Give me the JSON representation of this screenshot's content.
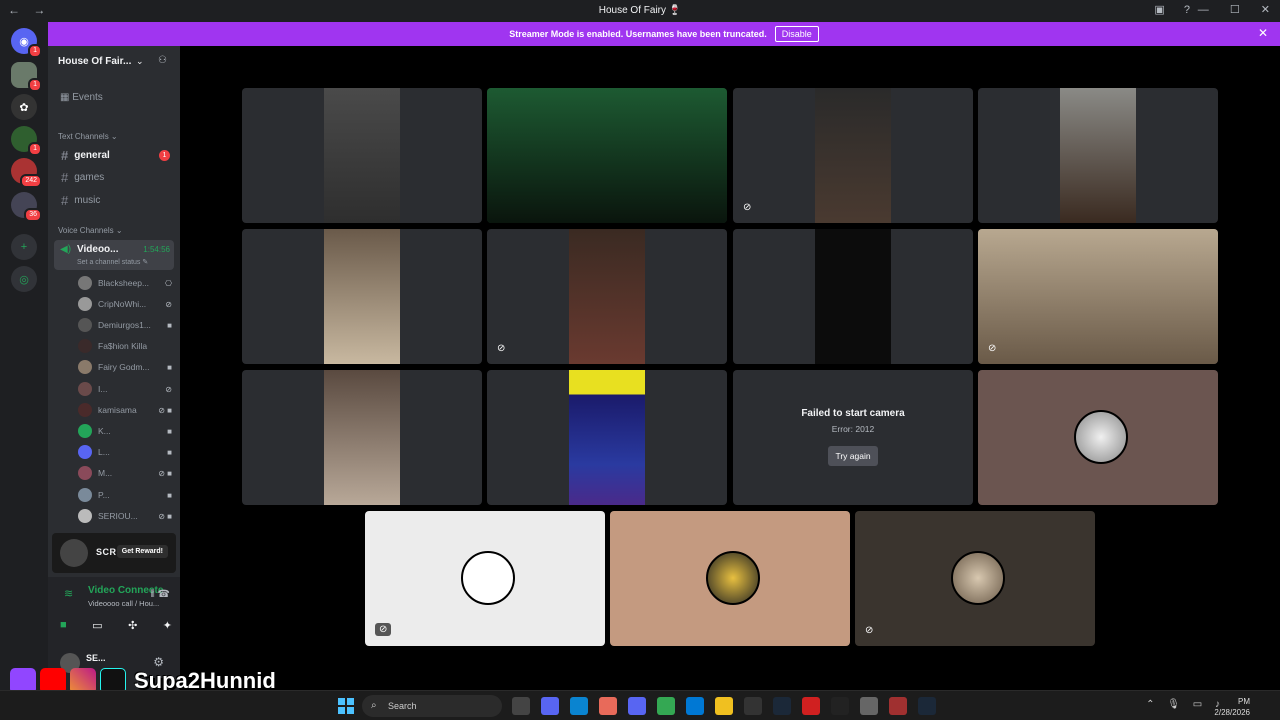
{
  "window": {
    "title": "House Of Fairy 🍷"
  },
  "banner": {
    "text": "Streamer Mode is enabled. Usernames have been truncated.",
    "button": "Disable"
  },
  "servers": {
    "badges": [
      "1",
      "1",
      "1",
      "242",
      "36"
    ]
  },
  "guild": {
    "name": "House Of Fair...",
    "events": "Events",
    "text_category": "Text Channels",
    "text_channels": [
      {
        "name": "general",
        "badge": "1"
      },
      {
        "name": "games"
      },
      {
        "name": "music"
      }
    ],
    "voice_category": "Voice Channels",
    "voice_channel": {
      "name": "Videoo...",
      "time": "1:54:56",
      "status": "Set a channel status"
    },
    "members": [
      "Blacksheep...",
      "CripNoWhi...",
      "Demiurgos1...",
      "Fa$hion Killa",
      "Fairy Godm...",
      "I...",
      "kamisama",
      "K...",
      "L...",
      "M...",
      "P...",
      "SERIOU..."
    ]
  },
  "promo": {
    "label": "SCREAM",
    "button": "Get Reward!"
  },
  "voice_panel": {
    "status": "Video Connecte",
    "sub": "Videoooo call / Hou..."
  },
  "user": {
    "name": "SE..."
  },
  "tiles": {
    "failed_title": "Failed to start camera",
    "failed_error": "Error: 2012",
    "retry": "Try again"
  },
  "taskbar": {
    "search": "Search",
    "time": "PM",
    "date": "2/28/2026"
  },
  "overlay": {
    "brand": "Supa2Hunnid"
  },
  "colors": {
    "accent": "#a035f0",
    "connected": "#23a559",
    "danger": "#f23f43"
  }
}
